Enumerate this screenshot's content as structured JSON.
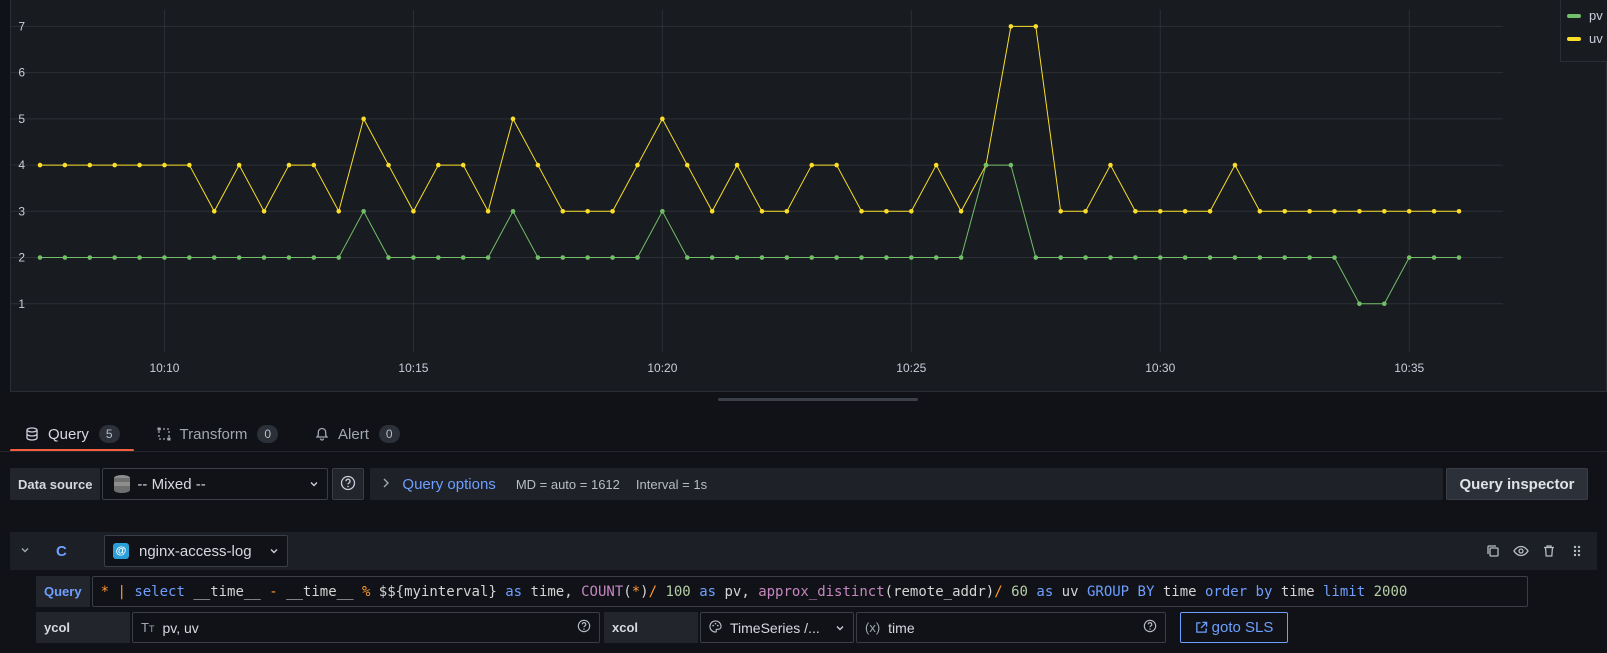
{
  "chart_data": {
    "type": "line",
    "x_labels": [
      "10:10",
      "10:15",
      "10:20",
      "10:25",
      "10:30",
      "10:35"
    ],
    "yticks": [
      1,
      2,
      3,
      4,
      5,
      6,
      7
    ],
    "ylim": [
      0,
      7.7
    ],
    "grid": true,
    "legend_placement": "top-right",
    "series": [
      {
        "name": "pv",
        "color": "#73bf69",
        "values": [
          2,
          2,
          2,
          2,
          2,
          2,
          2,
          2,
          2,
          2,
          2,
          2,
          2,
          3,
          2,
          2,
          2,
          2,
          2,
          3,
          2,
          2,
          2,
          2,
          2,
          3,
          2,
          2,
          2,
          2,
          2,
          2,
          2,
          2,
          2,
          2,
          2,
          2,
          4,
          4,
          2,
          2,
          2,
          2,
          2,
          2,
          2,
          2,
          2,
          2,
          2,
          2,
          2,
          1,
          1,
          2,
          2,
          2
        ]
      },
      {
        "name": "uv",
        "color": "#fade2a",
        "values": [
          4,
          4,
          4,
          4,
          4,
          4,
          4,
          3,
          4,
          3,
          4,
          4,
          3,
          5,
          4,
          3,
          4,
          4,
          3,
          5,
          4,
          3,
          3,
          3,
          4,
          5,
          4,
          3,
          4,
          3,
          3,
          4,
          4,
          3,
          3,
          3,
          4,
          3,
          4,
          7,
          7,
          3,
          3,
          4,
          3,
          3,
          3,
          3,
          4,
          3,
          3,
          3,
          3,
          3,
          3,
          3,
          3,
          3
        ]
      }
    ]
  },
  "tabs": [
    {
      "label": "Query",
      "count": "5"
    },
    {
      "label": "Transform",
      "count": "0"
    },
    {
      "label": "Alert",
      "count": "0"
    }
  ],
  "datasource": {
    "label": "Data source",
    "value": "-- Mixed --",
    "query_options_label": "Query options",
    "md": "MD = auto = 1612",
    "interval": "Interval = 1s",
    "inspector_label": "Query inspector"
  },
  "query_row": {
    "ref_id": "C",
    "datasource": "nginx-access-log",
    "query_label": "Query",
    "query_tokens": [
      {
        "t": "*",
        "c": "#ff9830"
      },
      {
        "t": " "
      },
      {
        "t": "|",
        "c": "#ff9830"
      },
      {
        "t": " "
      },
      {
        "t": "select",
        "c": "#6e9fff"
      },
      {
        "t": " __time__ "
      },
      {
        "t": "-",
        "c": "#ff9830"
      },
      {
        "t": " __time__ "
      },
      {
        "t": "%",
        "c": "#ff9830"
      },
      {
        "t": " $${myinterval} "
      },
      {
        "t": "as",
        "c": "#6e9fff"
      },
      {
        "t": " time, "
      },
      {
        "t": "COUNT",
        "c": "#c586c0"
      },
      {
        "t": "("
      },
      {
        "t": "*",
        "c": "#ff9830"
      },
      {
        "t": ")"
      },
      {
        "t": "/",
        "c": "#ff9830"
      },
      {
        "t": " "
      },
      {
        "t": "100",
        "c": "#b5cea8"
      },
      {
        "t": " "
      },
      {
        "t": "as",
        "c": "#6e9fff"
      },
      {
        "t": " pv, "
      },
      {
        "t": "approx_distinct",
        "c": "#c586c0"
      },
      {
        "t": "(remote_addr)"
      },
      {
        "t": "/",
        "c": "#ff9830"
      },
      {
        "t": " "
      },
      {
        "t": "60",
        "c": "#b5cea8"
      },
      {
        "t": " "
      },
      {
        "t": "as",
        "c": "#6e9fff"
      },
      {
        "t": " uv "
      },
      {
        "t": "GROUP BY",
        "c": "#6e9fff"
      },
      {
        "t": " time "
      },
      {
        "t": "order by",
        "c": "#6e9fff"
      },
      {
        "t": " time "
      },
      {
        "t": "limit",
        "c": "#6e9fff"
      },
      {
        "t": " "
      },
      {
        "t": "2000",
        "c": "#b5cea8"
      }
    ],
    "ycol_label": "ycol",
    "ycol_value": "pv, uv",
    "xcol_label": "xcol",
    "xcol_type": "TimeSeries /...",
    "xcol_value": "time",
    "goto_label": "goto SLS"
  },
  "icons": {
    "query_tab": "database-icon",
    "transform_tab": "transform-icon",
    "alert_tab": "bell-icon"
  }
}
